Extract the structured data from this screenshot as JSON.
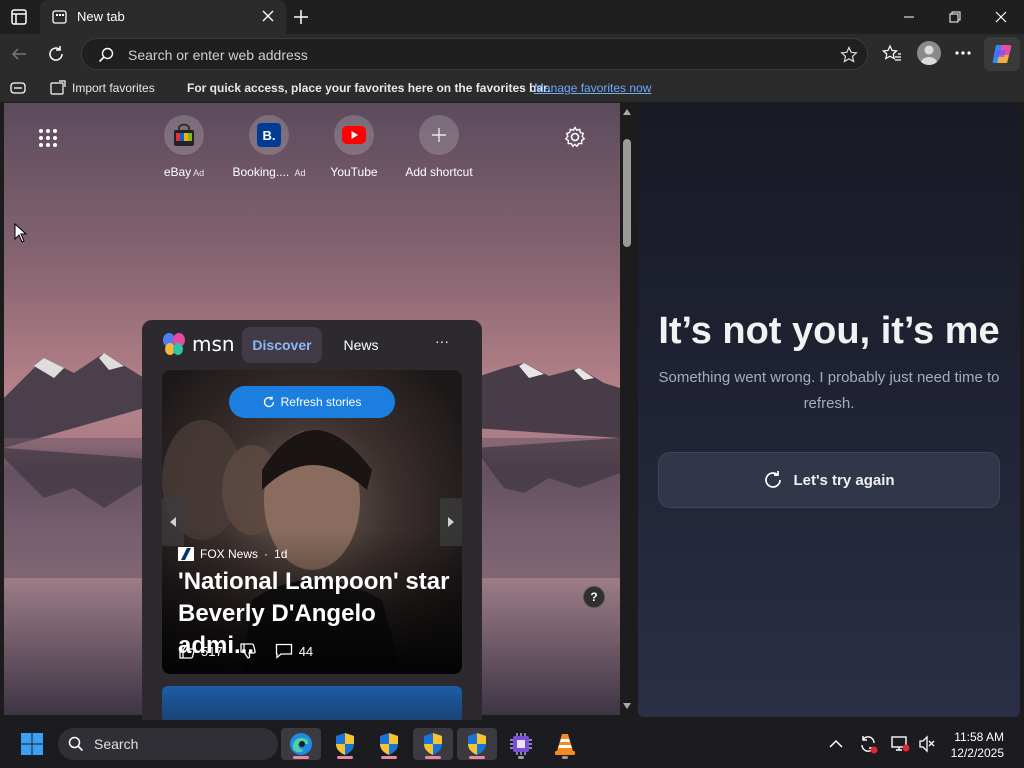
{
  "browser": {
    "tab_title": "New tab",
    "address_placeholder": "Search or enter web address"
  },
  "favorites_bar": {
    "import_label": "Import favorites",
    "message": "For quick access, place your favorites here on the favorites bar.",
    "manage_link": "Manage favorites now"
  },
  "shortcuts": [
    {
      "label": "eBay",
      "ad": "Ad",
      "icon": "ebay-bag-icon"
    },
    {
      "label": "Booking....",
      "ad": "Ad",
      "icon": "booking-icon",
      "letter": "B."
    },
    {
      "label": "YouTube",
      "ad": "",
      "icon": "youtube-icon"
    },
    {
      "label": "Add shortcut",
      "ad": "",
      "icon": "plus-icon"
    }
  ],
  "msn": {
    "brand": "msn",
    "tabs": [
      "Discover",
      "News"
    ],
    "more": "···",
    "refresh_label": "Refresh stories",
    "story": {
      "source": "FOX News",
      "age": "1d",
      "headline": "'National Lampoon' star Beverly D'Angelo admi...",
      "likes": "517",
      "comments": "44"
    },
    "help": "?"
  },
  "side_pane": {
    "heading": "It’s not you, it’s me",
    "message": "Something went wrong. I probably just need time to refresh.",
    "retry_label": "Let's try again"
  },
  "taskbar": {
    "search_label": "Search",
    "time": "11:58 AM",
    "date": "12/2/2025"
  },
  "colors": {
    "accent_blue": "#1c7fe0",
    "link_blue": "#6fa8f5",
    "discover_tab_text": "#8fb7f5"
  }
}
